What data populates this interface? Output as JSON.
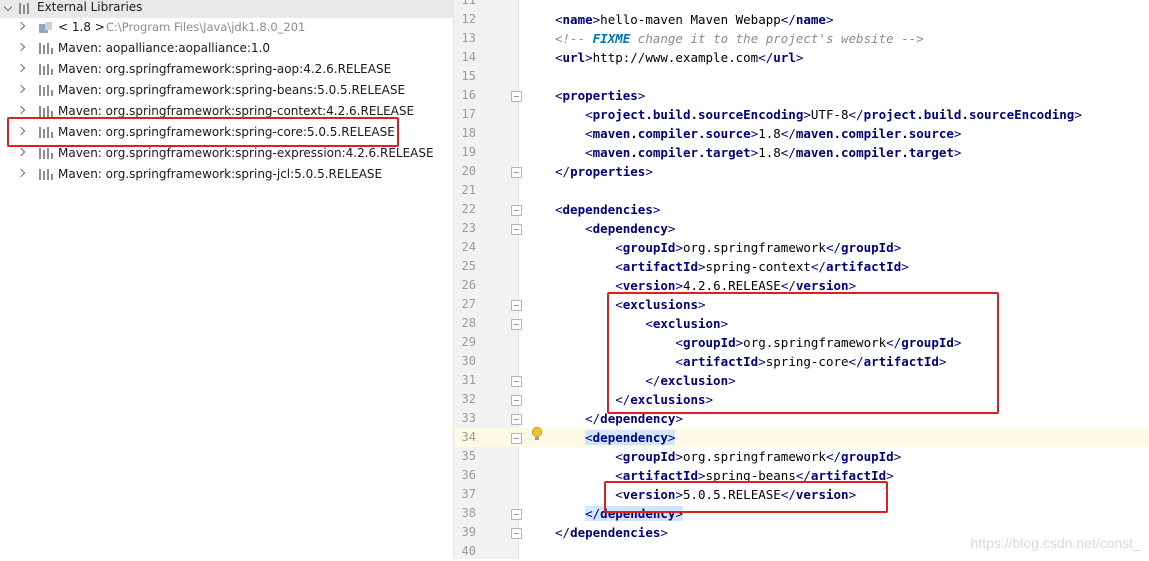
{
  "project_tree": {
    "root_label": "External Libraries",
    "items": [
      {
        "label": "< 1.8 >",
        "detail": "C:\\Program Files\\Java\\jdk1.8.0_201",
        "icon": "jdk-icon"
      },
      {
        "label": "Maven: aopalliance:aopalliance:1.0",
        "icon": "library-icon"
      },
      {
        "label": "Maven: org.springframework:spring-aop:4.2.6.RELEASE",
        "icon": "library-icon"
      },
      {
        "label": "Maven: org.springframework:spring-beans:5.0.5.RELEASE",
        "icon": "library-icon"
      },
      {
        "label": "Maven: org.springframework:spring-context:4.2.6.RELEASE",
        "icon": "library-icon"
      },
      {
        "label": "Maven: org.springframework:spring-core:5.0.5.RELEASE",
        "icon": "library-icon",
        "highlighted": true
      },
      {
        "label": "Maven: org.springframework:spring-expression:4.2.6.RELEASE",
        "icon": "library-icon"
      },
      {
        "label": "Maven: org.springframework:spring-jcl:5.0.5.RELEASE",
        "icon": "library-icon"
      }
    ]
  },
  "editor": {
    "lines": [
      {
        "n": "11",
        "text": ""
      },
      {
        "n": "12",
        "text": "<name>hello-maven Maven Webapp</name>"
      },
      {
        "n": "13",
        "text": "<!-- FIXME change it to the project's website -->"
      },
      {
        "n": "14",
        "text": "<url>http://www.example.com</url>"
      },
      {
        "n": "15",
        "text": ""
      },
      {
        "n": "16",
        "text": "<properties>"
      },
      {
        "n": "17",
        "text": "    <project.build.sourceEncoding>UTF-8</project.build.sourceEncoding>"
      },
      {
        "n": "18",
        "text": "    <maven.compiler.source>1.8</maven.compiler.source>"
      },
      {
        "n": "19",
        "text": "    <maven.compiler.target>1.8</maven.compiler.target>"
      },
      {
        "n": "20",
        "text": "</properties>"
      },
      {
        "n": "21",
        "text": ""
      },
      {
        "n": "22",
        "text": "<dependencies>"
      },
      {
        "n": "23",
        "text": "    <dependency>"
      },
      {
        "n": "24",
        "text": "        <groupId>org.springframework</groupId>"
      },
      {
        "n": "25",
        "text": "        <artifactId>spring-context</artifactId>"
      },
      {
        "n": "26",
        "text": "        <version>4.2.6.RELEASE</version>"
      },
      {
        "n": "27",
        "text": "        <exclusions>"
      },
      {
        "n": "28",
        "text": "            <exclusion>"
      },
      {
        "n": "29",
        "text": "                <groupId>org.springframework</groupId>"
      },
      {
        "n": "30",
        "text": "                <artifactId>spring-core</artifactId>"
      },
      {
        "n": "31",
        "text": "            </exclusion>"
      },
      {
        "n": "32",
        "text": "        </exclusions>"
      },
      {
        "n": "33",
        "text": "    </dependency>"
      },
      {
        "n": "34",
        "text": "    <dependency>"
      },
      {
        "n": "35",
        "text": "        <groupId>org.springframework</groupId>"
      },
      {
        "n": "36",
        "text": "        <artifactId>spring-beans</artifactId>"
      },
      {
        "n": "37",
        "text": "        <version>5.0.5.RELEASE</version>"
      },
      {
        "n": "38",
        "text": "    </dependency>"
      },
      {
        "n": "39",
        "text": "</dependencies>"
      },
      {
        "n": "40",
        "text": ""
      }
    ]
  },
  "watermark": "https://blog.csdn.net/const_",
  "colors": {
    "annotation_red": "#e02020",
    "tag": "#000080",
    "comment": "#8c8c8c",
    "todo": "#0073bf",
    "current_line": "#fcfae4",
    "selection": "#cfe6ff"
  }
}
